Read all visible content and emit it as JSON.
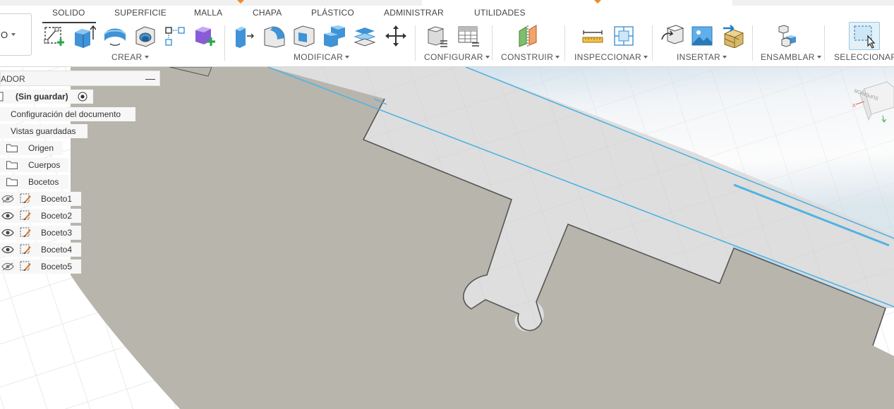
{
  "toolbar": {
    "workspace_value": "O",
    "tabs": [
      "SOLIDO",
      "SUPERFICIE",
      "MALLA",
      "CHAPA",
      "PLÁSTICO",
      "ADMINISTRAR",
      "UTILIDADES"
    ],
    "groups": {
      "crear": "CREAR",
      "modificar": "MODIFICAR",
      "configurar": "CONFIGURAR",
      "construir": "CONSTRUIR",
      "inspeccionar": "INSPECCIONAR",
      "insertar": "INSERTAR",
      "ensamblar": "ENSAMBLAR",
      "seleccionar": "SELECCIONAR"
    },
    "tool_icons": {
      "create_sketch": "create-sketch-icon",
      "extrude": "extrude-icon",
      "revolve": "revolve-icon",
      "hole": "hole-icon",
      "pattern": "pattern-icon",
      "new_component": "new-component-icon",
      "press_pull": "press-pull-icon",
      "fillet": "fillet-icon",
      "shell": "shell-icon",
      "combine": "combine-icon",
      "replace_face": "replace-face-icon",
      "move": "move-icon",
      "parameters": "parameters-icon",
      "table": "table-icon",
      "plane": "plane-icon",
      "measure": "measure-icon",
      "interference": "interference-icon",
      "insert_derive": "insert-derive-icon",
      "insert_image": "insert-image-icon",
      "insert_mesh": "insert-mesh-icon",
      "joint": "joint-icon",
      "select": "select-icon"
    }
  },
  "browser": {
    "title": "ADOR",
    "document_name": "(Sin guardar)",
    "items": [
      {
        "label": "Configuración del documento"
      },
      {
        "label": "Vistas guardadas"
      },
      {
        "label": "Origen"
      },
      {
        "label": "Cuerpos"
      },
      {
        "label": "Bocetos"
      }
    ],
    "sketches": [
      {
        "label": "Boceto1",
        "visible": false
      },
      {
        "label": "Boceto2",
        "visible": true
      },
      {
        "label": "Boceto3",
        "visible": true
      },
      {
        "label": "Boceto4",
        "visible": true
      },
      {
        "label": "Boceto5",
        "visible": false
      }
    ]
  },
  "viewcube": {
    "face_label": "SUPERIOR"
  },
  "colors": {
    "accent": "#0696d7",
    "body_fill": "#b8b5ad",
    "sketch_profile": "#dcdcdc",
    "sketch_line": "#4fb3e3",
    "grid": "#d8d8d8",
    "extrude_blue": "#3f93d6",
    "component_purple": "#8a5bd6",
    "add_green": "#2aa84a"
  }
}
